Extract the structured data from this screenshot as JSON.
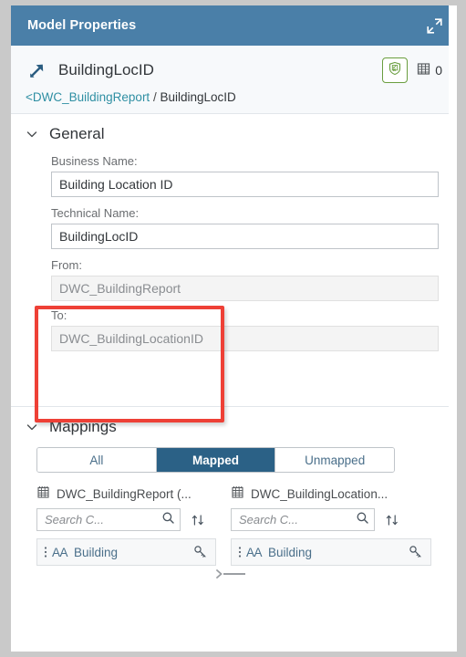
{
  "titlebar": {
    "title": "Model Properties",
    "expand_icon": "expand-icon"
  },
  "object_header": {
    "assoc_icon": "association-arrow-icon",
    "name": "BuildingLocID",
    "shield_icon": "shield-check-icon",
    "grid_icon": "table-grid-icon",
    "count": "0",
    "breadcrumb": {
      "parent": "<DWC_BuildingReport",
      "separator": "/",
      "current": "BuildingLocID"
    }
  },
  "general": {
    "chevron_icon": "chevron-down-icon",
    "title": "General",
    "fields": [
      {
        "label": "Business Name:",
        "value": "Building Location ID",
        "readonly": false
      },
      {
        "label": "Technical Name:",
        "value": "BuildingLocID",
        "readonly": false
      },
      {
        "label": "From:",
        "value": "DWC_BuildingReport",
        "readonly": true
      },
      {
        "label": "To:",
        "value": "DWC_BuildingLocationID",
        "readonly": true
      }
    ],
    "highlight_color": "#ee4036"
  },
  "mappings": {
    "chevron_icon": "chevron-down-icon",
    "title": "Mappings",
    "filter_tabs": [
      {
        "label": "All",
        "active": false
      },
      {
        "label": "Mapped",
        "active": true
      },
      {
        "label": "Unmapped",
        "active": false
      }
    ],
    "active_tab_color": "#2b6186",
    "source": {
      "table_icon": "table-icon",
      "table_name": "DWC_BuildingReport (...",
      "search_placeholder": "Search C...",
      "search_icon": "search-icon",
      "sort_icon": "sort-icon",
      "item": {
        "drag_icon": "drag-handle-icon",
        "type_icon": "AA",
        "label": "Building",
        "key_icon": "key-icon"
      }
    },
    "target": {
      "table_icon": "table-icon",
      "table_name": "DWC_BuildingLocation...",
      "search_placeholder": "Search C...",
      "search_icon": "search-icon",
      "sort_icon": "sort-icon",
      "item": {
        "drag_icon": "drag-handle-icon",
        "type_icon": "AA",
        "label": "Building",
        "key_icon": "key-icon"
      }
    }
  }
}
